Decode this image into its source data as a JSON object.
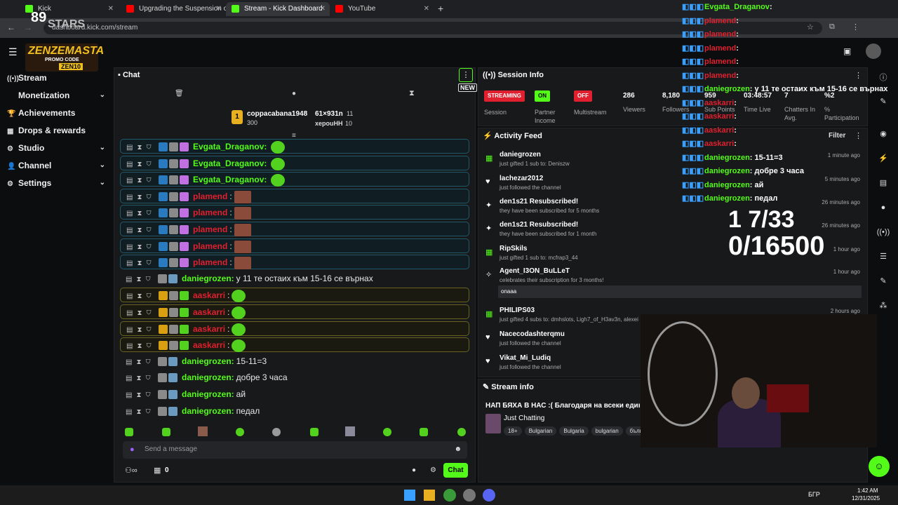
{
  "browser": {
    "tabs": [
      {
        "label": "Kick"
      },
      {
        "label": "Upgrading the Suspension on N"
      },
      {
        "label": "Stream - Kick Dashboard"
      },
      {
        "label": "YouTube"
      }
    ],
    "url": "dashboard.kick.com/stream",
    "new_tab": "+"
  },
  "overlay_logo": {
    "brand": "STARS",
    "promo_label": "PROMO CODE",
    "promo_code": "ZEN10"
  },
  "sidebar": {
    "items": [
      {
        "label": "Stream",
        "icon": "broadcast-icon"
      },
      {
        "label": "Monetization",
        "icon": "dollar-icon"
      },
      {
        "label": "Achievements",
        "icon": "trophy-icon"
      },
      {
        "label": "Drops & rewards",
        "icon": "gift-icon"
      },
      {
        "label": "Studio",
        "icon": "gear-icon"
      },
      {
        "label": "Channel",
        "icon": "person-icon"
      },
      {
        "label": "Settings",
        "icon": "cog-icon"
      }
    ]
  },
  "chat": {
    "title": "Chat",
    "new_badge": "NEW",
    "top_users": [
      {
        "name": "coppacabana1948",
        "count": "300"
      },
      {
        "name": "61×931n",
        "count": "11"
      },
      {
        "name": "xepouHH",
        "count": "10"
      }
    ],
    "messages": [
      {
        "user": "Evgata_Draganov:",
        "text": "",
        "style": "sub",
        "color": "#53fc18"
      },
      {
        "user": "Evgata_Draganov:",
        "text": "",
        "style": "sub",
        "color": "#53fc18"
      },
      {
        "user": "Evgata_Draganov:",
        "text": "",
        "style": "sub",
        "color": "#53fc18"
      },
      {
        "user": "plamend",
        "text": ":",
        "style": "sub",
        "color": "#e0202e"
      },
      {
        "user": "plamend",
        "text": ":",
        "style": "sub",
        "color": "#e0202e"
      },
      {
        "user": "plamend",
        "text": ":",
        "style": "sub",
        "color": "#e0202e"
      },
      {
        "user": "plamend",
        "text": ":",
        "style": "sub",
        "color": "#e0202e"
      },
      {
        "user": "plamend",
        "text": ":",
        "style": "sub",
        "color": "#e0202e"
      },
      {
        "user": "daniegrozen:",
        "text": "у 11 те остаих към 15-16 се върнах",
        "style": "plain",
        "color": "#53fc18"
      },
      {
        "user": "aaskarri",
        "text": ":",
        "style": "gold",
        "color": "#e0202e"
      },
      {
        "user": "aaskarri",
        "text": ":",
        "style": "gold",
        "color": "#e0202e"
      },
      {
        "user": "aaskarri",
        "text": ":",
        "style": "gold",
        "color": "#e0202e"
      },
      {
        "user": "aaskarri",
        "text": ":",
        "style": "gold",
        "color": "#e0202e"
      },
      {
        "user": "daniegrozen:",
        "text": "15-11=3",
        "style": "plain",
        "color": "#53fc18"
      },
      {
        "user": "daniegrozen:",
        "text": "добре 3 часа",
        "style": "plain",
        "color": "#53fc18"
      },
      {
        "user": "daniegrozen:",
        "text": "ай",
        "style": "plain",
        "color": "#53fc18"
      },
      {
        "user": "daniegrozen:",
        "text": "педал",
        "style": "plain",
        "color": "#53fc18"
      }
    ],
    "input_placeholder": "Send a message",
    "viewer_count": "0",
    "send_label": "Chat"
  },
  "session": {
    "title": "Session Info",
    "status": [
      {
        "badge": "STREAMING",
        "label": "Session",
        "color": "#e0202e"
      },
      {
        "badge": "ON",
        "label": "Partner Income",
        "color": "#53fc18"
      },
      {
        "badge": "OFF",
        "label": "Multistream",
        "color": "#e0202e"
      }
    ],
    "stats": [
      {
        "value": "286",
        "label": "Viewers"
      },
      {
        "value": "8,180",
        "label": "Followers"
      },
      {
        "value": "959",
        "label": "Sub Points"
      },
      {
        "value": "03:48:57",
        "label": "Time Live"
      },
      {
        "value": "7",
        "label": "Chatters In Avg."
      },
      {
        "value": "%2",
        "label": "% Participation"
      }
    ]
  },
  "activity": {
    "title": "Activity Feed",
    "filter": "Filter",
    "items": [
      {
        "title": "daniegrozen",
        "sub": "just gifted 1 sub to: Deniszw",
        "time": "1 minute ago",
        "icon": "gift-icon"
      },
      {
        "title": "lachezar2012",
        "sub": "just followed the channel",
        "time": "5 minutes ago",
        "icon": "heart-icon"
      },
      {
        "title": "den1s21 Resubscribed!",
        "sub": "they have been subscribed for 5 months",
        "time": "26 minutes ago",
        "icon": "star-icon"
      },
      {
        "title": "den1s21 Resubscribed!",
        "sub": "they have been subscribed for 1 month",
        "time": "26 minutes ago",
        "icon": "star-icon"
      },
      {
        "title": "RipSkils",
        "sub": "just gifted 1 sub to: mcfrap3_44",
        "time": "1 hour ago",
        "icon": "gift-icon"
      },
      {
        "title": "Agent_I3ON_BuLLeT",
        "sub": "celebrates their subscription for 3 months!",
        "time": "1 hour ago",
        "icon": "celebrate-icon",
        "message": "onaaa"
      },
      {
        "title": "PHILIPS03",
        "sub": "just gifted 4 subs to: dmhslots, Ligh7_of_H3av3n, alexei",
        "time": "2 hours ago",
        "icon": "gift-icon"
      },
      {
        "title": "Nacecodashterqmu",
        "sub": "just followed the channel",
        "time": "",
        "icon": "heart-icon"
      },
      {
        "title": "Vikat_Mi_Ludiq",
        "sub": "just followed the channel",
        "time": "",
        "icon": "heart-icon"
      }
    ]
  },
  "stream_info": {
    "title": "Stream info",
    "stream_title": "НАП БЯХА В НАС :( Благодаря на всеки един",
    "category": "Just Chatting",
    "tags": [
      "18+",
      "Bulgarian",
      "Bulgaria",
      "bulgarian",
      "бълга"
    ]
  },
  "overlay": {
    "chat": [
      {
        "user": "Evgata_Draganov",
        "text": ":"
      },
      {
        "user": "plamend",
        "text": ":"
      },
      {
        "user": "plamend",
        "text": ":"
      },
      {
        "user": "plamend",
        "text": ":"
      },
      {
        "user": "plamend",
        "text": ":"
      },
      {
        "user": "plamend",
        "text": ":"
      },
      {
        "user": "daniegrozen",
        "text": ": у 11 те остаих към 15-16 се върнах"
      },
      {
        "user": "aaskarri",
        "text": ":"
      },
      {
        "user": "aaskarri",
        "text": ":"
      },
      {
        "user": "aaskarri",
        "text": ":"
      },
      {
        "user": "aaskarri",
        "text": ":"
      },
      {
        "user": "daniegrozen",
        "text": ": 15-11=3"
      },
      {
        "user": "daniegrozen",
        "text": ": добре 3 часа"
      },
      {
        "user": "daniegrozen",
        "text": ": ай"
      },
      {
        "user": "daniegrozen",
        "text": ": педал"
      }
    ],
    "goal_line1": "1 7/33",
    "goal_line2": "0/16500"
  },
  "taskbar": {
    "time": "1:42 AM",
    "date": "12/31/2025",
    "lang": "БГР"
  }
}
